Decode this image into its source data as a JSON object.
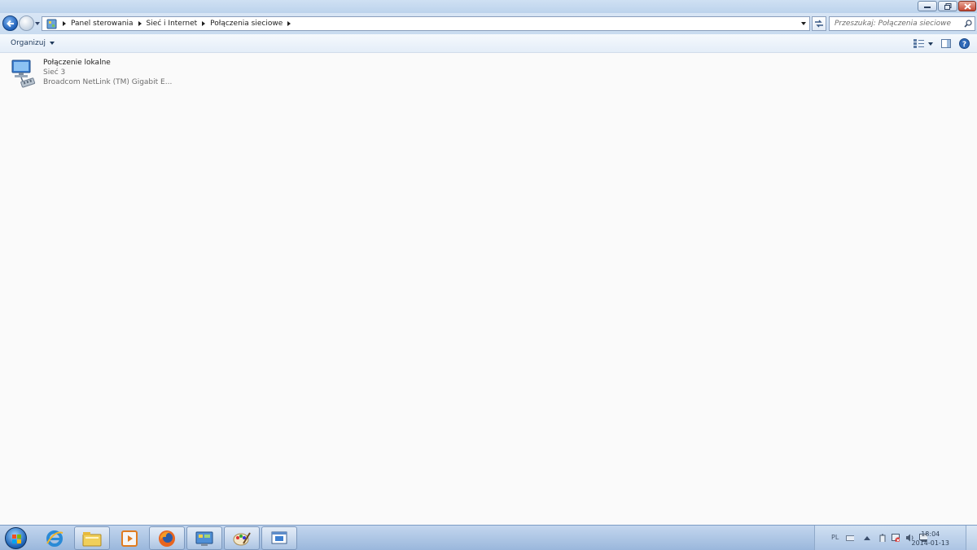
{
  "address_bar": {
    "crumbs": [
      "Panel sterowania",
      "Sieć i Internet",
      "Połączenia sieciowe"
    ]
  },
  "search": {
    "placeholder": "Przeszukaj: Połączenia sieciowe"
  },
  "command_bar": {
    "organize_label": "Organizuj"
  },
  "connections": [
    {
      "name": "Połączenie lokalne",
      "network": "Sieć  3",
      "adapter": "Broadcom NetLink (TM) Gigabit E..."
    }
  ],
  "taskbar": {
    "apps": [
      "internet-explorer",
      "windows-explorer",
      "media-player",
      "firefox",
      "control-panel",
      "paint",
      "network-connections-window"
    ],
    "language": "PL",
    "time": "18:04",
    "date": "2014-01-13"
  },
  "colors": {
    "accent": "#1d5fb9",
    "link": "#1e395b",
    "secondary_text": "#6d6d6d"
  }
}
